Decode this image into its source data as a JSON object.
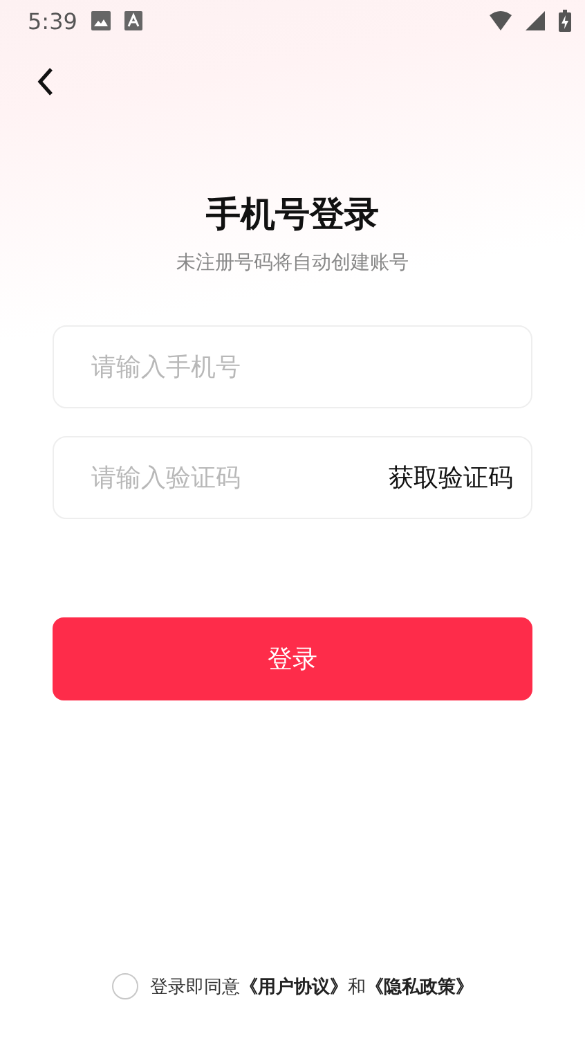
{
  "status_bar": {
    "time": "5:39"
  },
  "title": "手机号登录",
  "subtitle": "未注册号码将自动创建账号",
  "phone_field": {
    "placeholder": "请输入手机号"
  },
  "code_field": {
    "placeholder": "请输入验证码",
    "action": "获取验证码"
  },
  "login_button": "登录",
  "agreement": {
    "checked": false,
    "prefix": "登录即同意",
    "terms_link": "《用户协议》",
    "joiner": "和",
    "privacy_link": "《隐私政策》"
  }
}
